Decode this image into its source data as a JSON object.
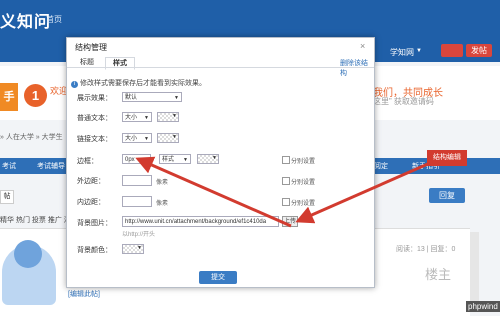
{
  "site": {
    "logo": "义知问",
    "home": "首页",
    "top_nav": "学知网",
    "post_button": "发帖"
  },
  "banner": {
    "promo_char": "手",
    "step_number": "1",
    "welcome": "欢迎",
    "join_text": "我们，共同成长",
    "invite_text": "这里” 获取邀请码"
  },
  "breadcrumb": "» 人在大学 » 大学生",
  "tabbar": {
    "left": "考试",
    "award": "考试辅导",
    "right1": "阅定",
    "right2": "新手指引"
  },
  "post_area": {
    "action_btn": "帖",
    "reply_button": "回复",
    "filters": "精华 热门 投票 推广 活动",
    "edit_link": "[编辑此帖]",
    "stats": "阅读：13  |  回复：0",
    "floor": "楼主",
    "red_tag": "结构编辑",
    "watermark": "phpwind"
  },
  "modal": {
    "title": "结构管理",
    "close": "×",
    "tabs": [
      "标题",
      "样式"
    ],
    "delete_link": "删除该结构",
    "tip": "修改样式需要保存后才能看到实际效果。",
    "display_label": "展示效果：",
    "display_value": "默认",
    "normal_text_label": "普通文本：",
    "normal_size": "大小",
    "link_text_label": "链接文本：",
    "link_size": "大小",
    "border_label": "边框：",
    "border_width": "0px",
    "border_style": "样式",
    "border_separate": "分别设置",
    "margin_label": "外边距：",
    "margin_unit": "像素",
    "margin_separate": "分别设置",
    "padding_label": "内边距：",
    "padding_unit": "像素",
    "padding_separate": "分别设置",
    "bg_image_label": "背景图片：",
    "bg_image_value": "http://www.unit.cn/attachment/background/ef1c410da",
    "bg_image_button": "上传",
    "bg_image_hint": "以http://开头",
    "bg_color_label": "背景颜色：",
    "confirm": "提交"
  },
  "colors": {
    "header_blue": "#1f5fa8",
    "accent_orange": "#e8622a",
    "annotation_red": "#d23b2f",
    "button_blue": "#3a7cc4"
  }
}
